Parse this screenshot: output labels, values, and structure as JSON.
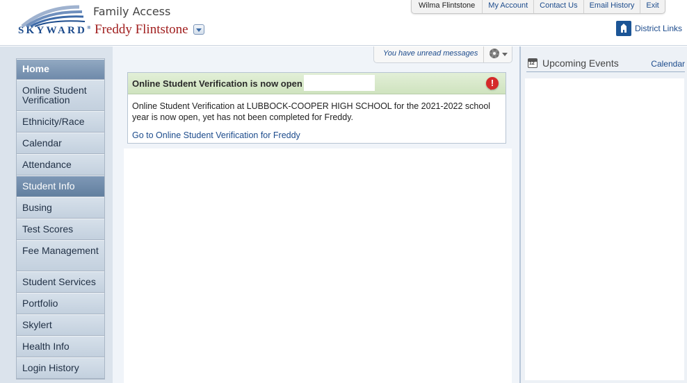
{
  "header": {
    "logo_text": "SKYWARD",
    "app_name": "Family Access",
    "student_name": "Freddy Flintstone",
    "user_nav": [
      "Wilma Flintstone",
      "My Account",
      "Contact Us",
      "Email History",
      "Exit"
    ],
    "district_links": "District Links"
  },
  "sidebar": {
    "items": [
      {
        "label": "Home"
      },
      {
        "label": "Online Student Verification"
      },
      {
        "label": "Ethnicity/Race"
      },
      {
        "label": "Calendar"
      },
      {
        "label": "Attendance"
      },
      {
        "label": "Student Info"
      },
      {
        "label": "Busing"
      },
      {
        "label": "Test Scores"
      },
      {
        "label": "Fee Management"
      },
      {
        "label": "Student Services"
      },
      {
        "label": "Portfolio"
      },
      {
        "label": "Skylert"
      },
      {
        "label": "Health Info"
      },
      {
        "label": "Login History"
      }
    ]
  },
  "main": {
    "messages_text": "You have unread messages",
    "notice": {
      "title": "Online Student Verification is now open",
      "body": "Online Student Verification at LUBBOCK-COOPER HIGH SCHOOL for the 2021-2022 school year is now open, yet has not been completed for Freddy.",
      "link": "Go to Online Student Verification for Freddy"
    }
  },
  "right_panel": {
    "title": "Upcoming Events",
    "calendar_link": "Calendar"
  },
  "colors": {
    "brand_blue": "#1c4b8c",
    "student_red": "#a01d1d",
    "nav_active": "#627f9f",
    "notice_green": "#cfe3bf",
    "alert_red": "#d52a2a",
    "annotation_arrow": "#e8231d"
  },
  "icons": [
    "skyward-logo",
    "student-dropdown-icon",
    "district-links-icon",
    "settings-gear-icon",
    "alert-icon",
    "calendar-icon",
    "red-arrow-annotation"
  ]
}
